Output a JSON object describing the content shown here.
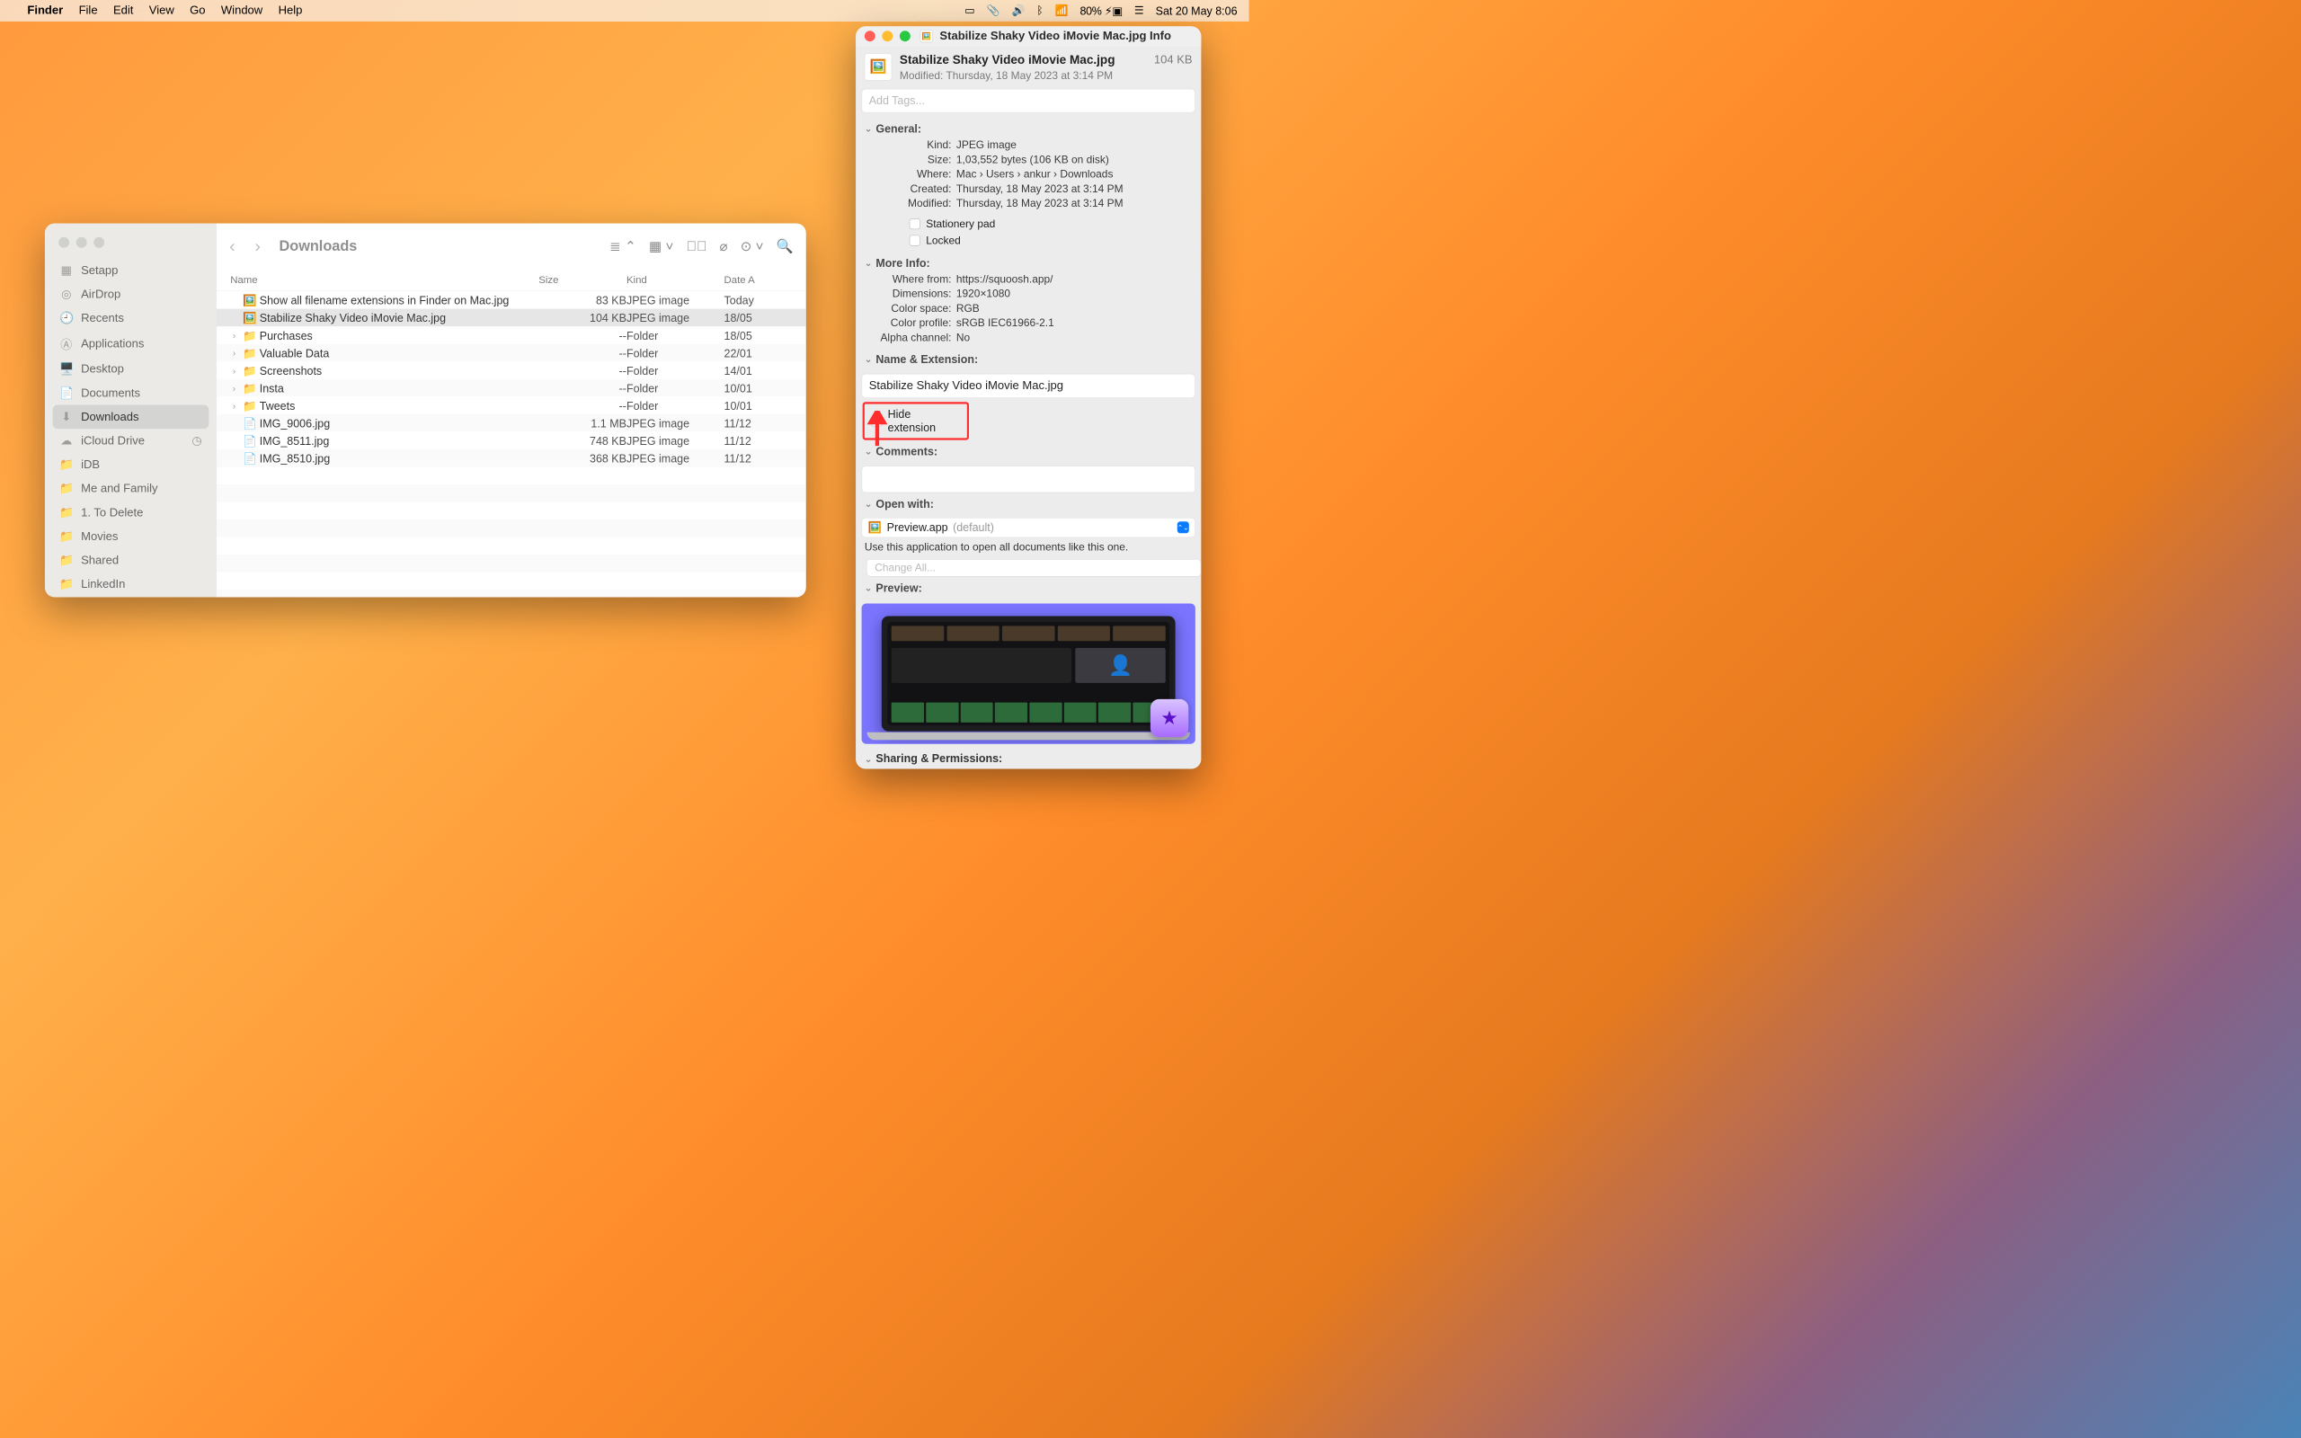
{
  "menubar": {
    "app": "Finder",
    "items": [
      "File",
      "Edit",
      "View",
      "Go",
      "Window",
      "Help"
    ],
    "battery": "80%",
    "clock": "Sat 20 May  8:06"
  },
  "finder": {
    "location": "Downloads",
    "sidebar": [
      {
        "icon": "grid",
        "label": "Setapp"
      },
      {
        "icon": "airdrop",
        "label": "AirDrop"
      },
      {
        "icon": "clock",
        "label": "Recents"
      },
      {
        "icon": "apps",
        "label": "Applications"
      },
      {
        "icon": "desktop",
        "label": "Desktop"
      },
      {
        "icon": "doc",
        "label": "Documents"
      },
      {
        "icon": "download",
        "label": "Downloads",
        "active": true
      },
      {
        "icon": "icloud",
        "label": "iCloud Drive",
        "right": "◷"
      },
      {
        "icon": "folder",
        "label": "iDB"
      },
      {
        "icon": "folder",
        "label": "Me and Family"
      },
      {
        "icon": "folder",
        "label": "1. To Delete"
      },
      {
        "icon": "folder",
        "label": "Movies"
      },
      {
        "icon": "folder",
        "label": "Shared"
      },
      {
        "icon": "folder",
        "label": "LinkedIn"
      }
    ],
    "columns": {
      "name": "Name",
      "size": "Size",
      "kind": "Kind",
      "date": "Date A"
    },
    "rows": [
      {
        "icon": "🖼️",
        "name": "Show all filename extensions in Finder on Mac.jpg",
        "size": "83 KB",
        "kind": "JPEG image",
        "date": "Today"
      },
      {
        "icon": "🖼️",
        "name": "Stabilize Shaky Video iMovie Mac.jpg",
        "size": "104 KB",
        "kind": "JPEG image",
        "date": "18/05",
        "selected": true
      },
      {
        "disclose": "›",
        "icon": "📁",
        "name": "Purchases",
        "size": "--",
        "kind": "Folder",
        "date": "18/05"
      },
      {
        "disclose": "›",
        "icon": "📁",
        "name": "Valuable Data",
        "size": "--",
        "kind": "Folder",
        "date": "22/01"
      },
      {
        "disclose": "›",
        "icon": "📁",
        "name": "Screenshots",
        "size": "--",
        "kind": "Folder",
        "date": "14/01"
      },
      {
        "disclose": "›",
        "icon": "📁",
        "name": "Insta",
        "size": "--",
        "kind": "Folder",
        "date": "10/01"
      },
      {
        "disclose": "›",
        "icon": "📁",
        "name": "Tweets",
        "size": "--",
        "kind": "Folder",
        "date": "10/01"
      },
      {
        "icon": "📄",
        "name": "IMG_9006.jpg",
        "size": "1.1 MB",
        "kind": "JPEG image",
        "date": "11/12"
      },
      {
        "icon": "📄",
        "name": "IMG_8511.jpg",
        "size": "748 KB",
        "kind": "JPEG image",
        "date": "11/12"
      },
      {
        "icon": "📄",
        "name": "IMG_8510.jpg",
        "size": "368 KB",
        "kind": "JPEG image",
        "date": "11/12"
      }
    ]
  },
  "info": {
    "title": "Stabilize Shaky Video iMovie Mac.jpg Info",
    "name": "Stabilize Shaky Video iMovie Mac.jpg",
    "size": "104 KB",
    "modified_label": "Modified:",
    "modified": "Thursday, 18 May 2023 at 3:14 PM",
    "tags_placeholder": "Add Tags...",
    "sections": {
      "general": "General:",
      "moreinfo": "More Info:",
      "nameext": "Name & Extension:",
      "comments": "Comments:",
      "openwith": "Open with:",
      "preview": "Preview:",
      "sharing": "Sharing & Permissions:"
    },
    "general": {
      "Kind": "JPEG image",
      "Size": "1,03,552 bytes (106 KB on disk)",
      "Where": "Mac › Users › ankur › Downloads",
      "Created": "Thursday, 18 May 2023 at 3:14 PM",
      "Modified": "Thursday, 18 May 2023 at 3:14 PM"
    },
    "general_checks": {
      "stationery": "Stationery pad",
      "locked": "Locked"
    },
    "moreinfo": {
      "Where from": "https://squoosh.app/",
      "Dimensions": "1920×1080",
      "Color space": "RGB",
      "Color profile": "sRGB IEC61966-2.1",
      "Alpha channel": "No"
    },
    "nameext_value": "Stabilize Shaky Video iMovie Mac.jpg",
    "hideext": "Hide extension",
    "openwith": {
      "app": "Preview.app",
      "suffix": "(default)",
      "note": "Use this application to open all documents like this one.",
      "change": "Change All..."
    }
  }
}
